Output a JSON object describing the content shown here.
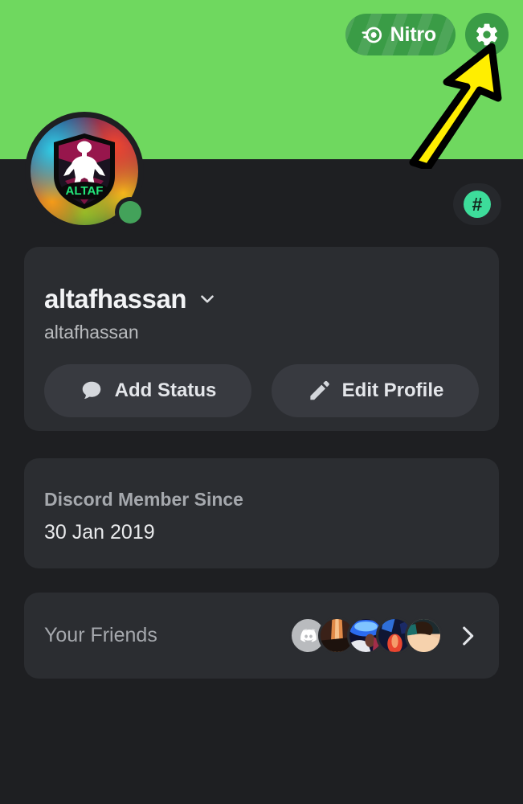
{
  "banner": {
    "color": "#6fd85f"
  },
  "top_actions": {
    "nitro_label": "Nitro",
    "nitro_icon": "nitro-boost-icon",
    "settings_icon": "gear-icon"
  },
  "annotation": {
    "type": "arrow",
    "color": "#ffee00",
    "outline_color": "#000000",
    "points_to": "settings-gear-button"
  },
  "avatar": {
    "logo_text": "ALTAF",
    "status": "online",
    "status_color": "#43a25a"
  },
  "hash_badge": {
    "glyph": "#",
    "color": "#3ddc9a"
  },
  "identity": {
    "display_name": "altafhassan",
    "username": "altafhassan",
    "chevron_icon": "chevron-down-icon",
    "actions": [
      {
        "label": "Add Status",
        "icon": "speech-bubble-icon"
      },
      {
        "label": "Edit Profile",
        "icon": "pencil-icon"
      }
    ]
  },
  "member_since": {
    "label": "Discord Member Since",
    "date": "30 Jan 2019"
  },
  "friends": {
    "label": "Your Friends",
    "chevron_icon": "chevron-right-icon",
    "avatars": [
      {
        "name": "discord-default-avatar"
      },
      {
        "name": "friend-avatar-2"
      },
      {
        "name": "friend-avatar-3"
      },
      {
        "name": "friend-avatar-4"
      },
      {
        "name": "friend-avatar-5"
      }
    ]
  }
}
